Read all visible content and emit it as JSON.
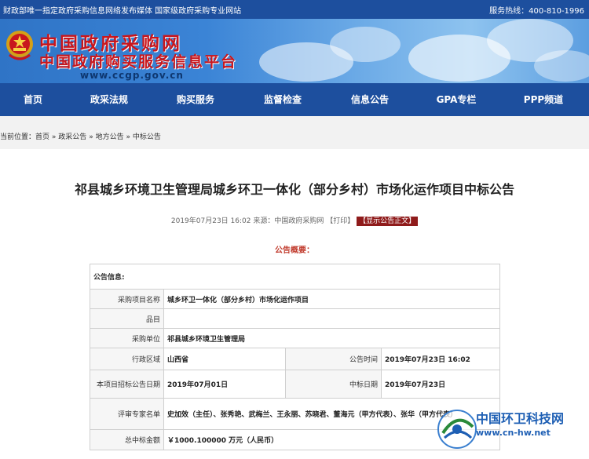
{
  "topbar": {
    "notice": "财政部唯一指定政府采购信息网络发布媒体 国家级政府采购专业网站",
    "hotline": "服务热线：400-810-1996"
  },
  "banner": {
    "title": "中国政府采购网",
    "subtitle": "中国政府购买服务信息平台",
    "url": "www.ccgp.gov.cn"
  },
  "nav": {
    "items": [
      "首页",
      "政采法规",
      "购买服务",
      "监督检查",
      "信息公告",
      "GPA专栏",
      "PPP频道"
    ]
  },
  "breadcrumb": {
    "prefix": "当前位置：",
    "items": [
      "首页",
      "政采公告",
      "地方公告",
      "中标公告"
    ],
    "separator": "»"
  },
  "article": {
    "title": "祁县城乡环境卫生管理局城乡环卫一体化（部分乡村）市场化运作项目中标公告",
    "meta": "2019年07月23日 16:02 来源：中国政府采购网 【打印】",
    "show_body": "【显示公告正文】",
    "summary_label": "公告概要："
  },
  "table": {
    "section": "公告信息:",
    "project_name_label": "采购项目名称",
    "project_name": "城乡环卫一体化（部分乡村）市场化运作项目",
    "item_label": "品目",
    "item": "",
    "unit_label": "采购单位",
    "unit": "祁县城乡环境卫生管理局",
    "region_label": "行政区域",
    "region": "山西省",
    "announce_time_label": "公告时间",
    "announce_time": "2019年07月23日 16:02",
    "tender_date_label": "本项目招标公告日期",
    "tender_date": "2019年07月01日",
    "award_date_label": "中标日期",
    "award_date": "2019年07月23日",
    "experts_label": "评审专家名单",
    "experts": "史加效（主任）、张秀艳、武梅兰、王永丽、苏晓君、董海元（甲方代表）、张华（甲方代表）",
    "amount_label": "总中标金额",
    "amount": "￥1000.100000 万元（人民币）"
  },
  "watermark": {
    "name": "中国环卫科技网",
    "url": "www.cn-hw.net"
  },
  "colors": {
    "nav": "#1d4f9e",
    "brand_red": "#c8161d",
    "label_red": "#c0392b"
  }
}
